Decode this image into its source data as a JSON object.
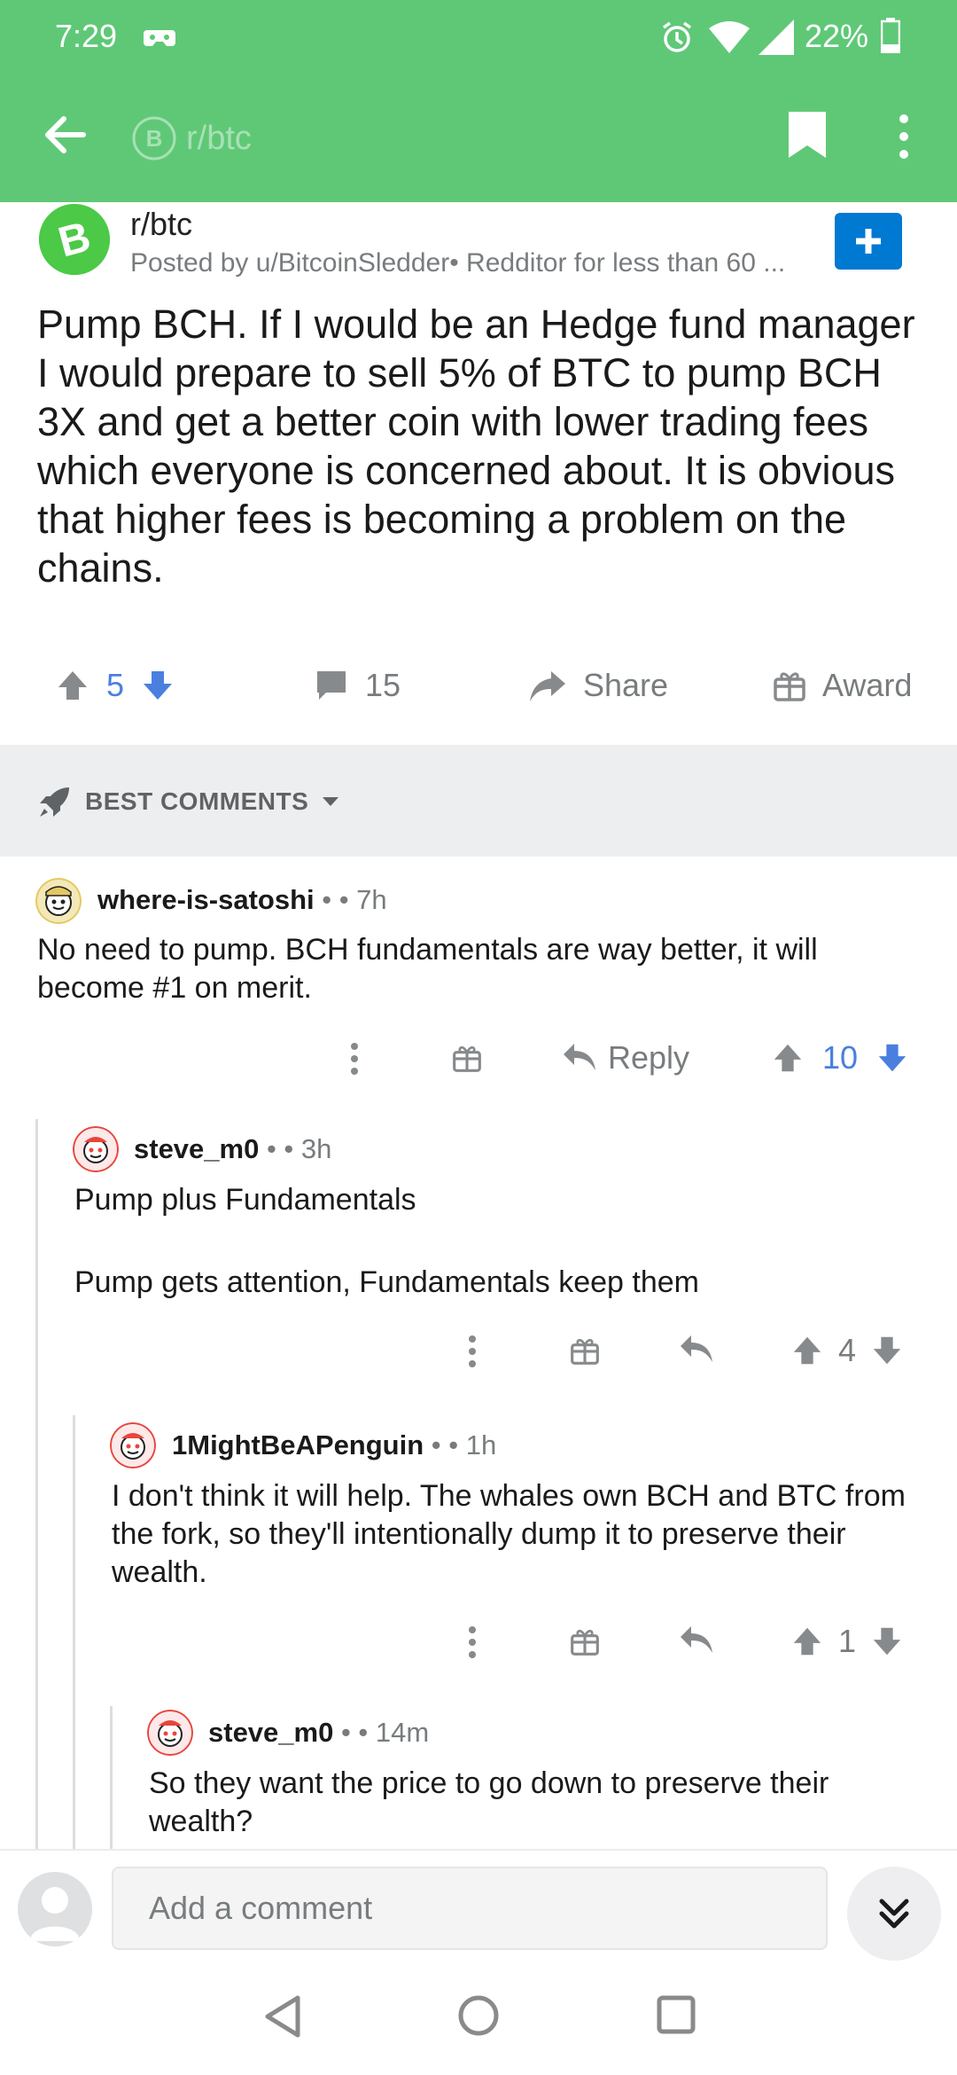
{
  "status": {
    "time": "7:29",
    "battery": "22%"
  },
  "appbar": {
    "subreddit": "r/btc"
  },
  "post": {
    "subreddit": "r/btc",
    "posted_by": "Posted by u/BitcoinSledder• Redditor for less than 60 ...",
    "title": "Pump BCH. If I would be an Hedge fund manager I would prepare to sell 5% of BTC to pump BCH 3X and get a better coin with lower trading fees which everyone is concerned about. It is obvious that higher fees is becoming a problem on the chains.",
    "score": "5",
    "comments": "15",
    "share_label": "Share",
    "award_label": "Award"
  },
  "sort": {
    "label": "BEST COMMENTS"
  },
  "comments": [
    {
      "author": "where-is-satoshi",
      "meta": " •  • 7h",
      "body": "No need to pump. BCH fundamentals are way better, it will become #1 on merit.",
      "reply_label": "Reply",
      "score": "10"
    },
    {
      "author": "steve_m0",
      "meta": " •  • 3h",
      "body_lines": [
        "Pump plus Fundamentals",
        "Pump gets attention, Fundamentals keep them"
      ],
      "score": "4"
    },
    {
      "author": "1MightBeAPenguin",
      "meta": " •  • 1h",
      "body": "I don't think it will help. The whales own BCH and BTC from the fork, so they'll intentionally dump it to preserve their wealth.",
      "score": "1"
    },
    {
      "author": "steve_m0",
      "meta": " •  • 14m",
      "body": "So they want the price to go down to preserve their wealth?"
    }
  ],
  "compose": {
    "placeholder": "Add a comment"
  },
  "colors": {
    "header": "#5fc877",
    "upvote_active": "#4a7fe0",
    "join": "#0079d3"
  },
  "icons": [
    "back-arrow-icon",
    "bookmark-icon",
    "more-vert-icon",
    "upvote-icon",
    "downvote-icon",
    "comment-icon",
    "share-icon",
    "gift-icon",
    "rocket-icon",
    "reply-icon",
    "chevron-double-down-icon"
  ]
}
